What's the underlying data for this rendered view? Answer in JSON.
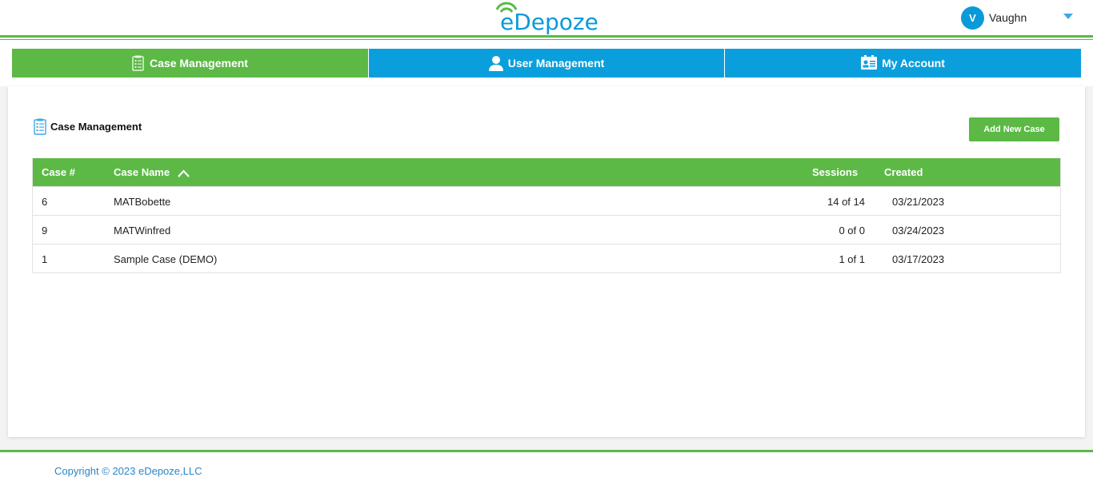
{
  "brand": {
    "logo_text": "eDepoze",
    "accent_green": "#5cb946",
    "accent_blue": "#0a9fdc"
  },
  "user": {
    "initial": "V",
    "name": "Vaughn",
    "menu_icon": "caret-down-icon"
  },
  "nav": {
    "tabs": [
      {
        "label": "Case Management",
        "icon": "clipboard-list-icon",
        "active": true
      },
      {
        "label": "User Management",
        "icon": "user-icon",
        "active": false
      },
      {
        "label": "My Account",
        "icon": "id-card-icon",
        "active": false
      }
    ]
  },
  "main": {
    "title": "Case Management",
    "title_icon": "clipboard-list-icon",
    "add_button_label": "Add New Case",
    "table": {
      "headers": {
        "case_num": "Case #",
        "case_name": "Case Name",
        "sessions": "Sessions",
        "created": "Created"
      },
      "sort": {
        "column": "case_name",
        "direction": "ascending"
      },
      "rows": [
        {
          "case_num": "6",
          "case_name": "MATBobette",
          "sessions": "14 of 14",
          "created": "03/21/2023"
        },
        {
          "case_num": "9",
          "case_name": "MATWinfred",
          "sessions": "0 of 0",
          "created": "03/24/2023"
        },
        {
          "case_num": "1",
          "case_name": "Sample Case (DEMO)",
          "sessions": "1 of 1",
          "created": "03/17/2023"
        }
      ]
    }
  },
  "footer": {
    "copyright": "Copyright © 2023 eDepoze,LLC"
  }
}
